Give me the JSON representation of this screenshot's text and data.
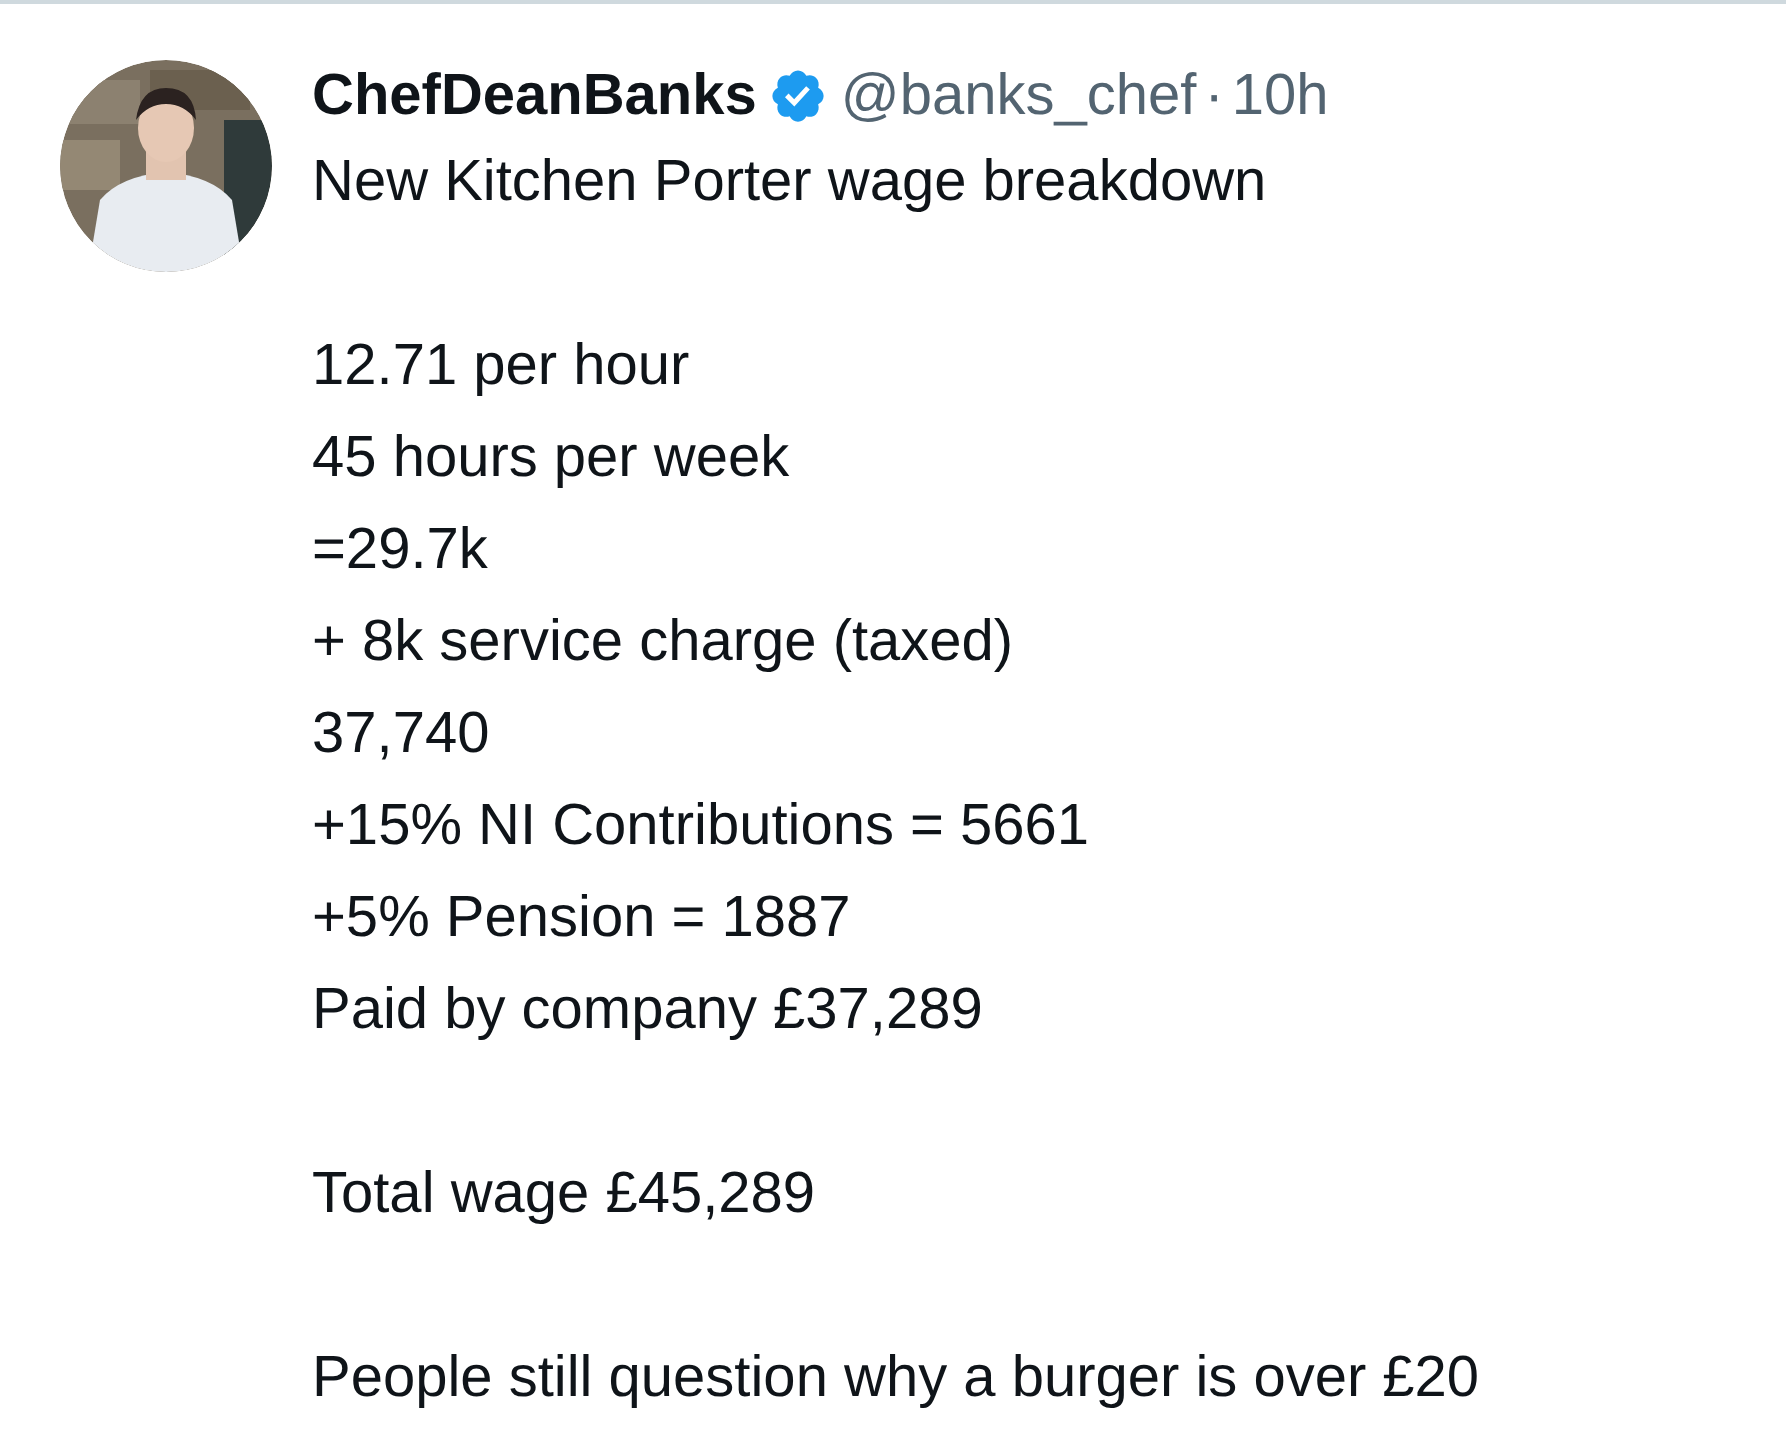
{
  "tweet": {
    "author": {
      "name": "ChefDeanBanks",
      "verified": true,
      "handle": "@banks_chef",
      "separator": "·",
      "time": "10h"
    },
    "paragraphs": [
      [
        "New Kitchen Porter wage breakdown"
      ],
      [
        "12.71 per hour",
        "45 hours per week",
        "=29.7k",
        "+ 8k service charge (taxed)",
        "37,740",
        "+15% NI Contributions = 5661",
        "+5% Pension = 1887",
        "Paid by company £37,289"
      ],
      [
        "Total wage £45,289"
      ],
      [
        "People still question why a burger is over £20"
      ]
    ]
  }
}
